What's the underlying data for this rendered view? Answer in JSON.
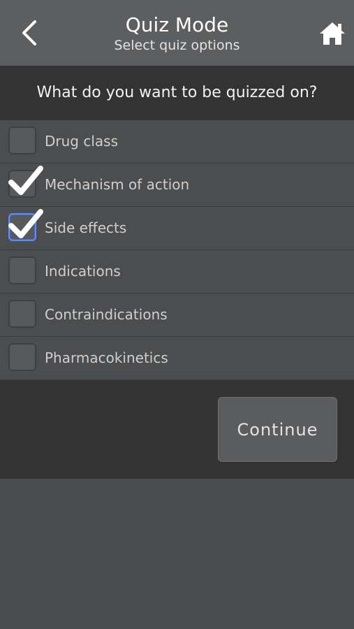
{
  "header": {
    "title": "Quiz Mode",
    "subtitle": "Select quiz options",
    "back_icon": "chevron-left-icon",
    "home_icon": "home-icon"
  },
  "prompt": "What do you want to be quizzed on?",
  "options": [
    {
      "label": "Drug class",
      "checked": false
    },
    {
      "label": "Mechanism of action",
      "checked": true
    },
    {
      "label": "Side effects",
      "checked": true,
      "focused": true
    },
    {
      "label": "Indications",
      "checked": false
    },
    {
      "label": "Contraindications",
      "checked": false
    },
    {
      "label": "Pharmacokinetics",
      "checked": false
    }
  ],
  "continue_label": "Continue",
  "colors": {
    "header_bg": "#5d5e60",
    "band_bg": "#333334",
    "list_bg": "#4c4d4f",
    "focus_accent": "#5b8dff"
  }
}
